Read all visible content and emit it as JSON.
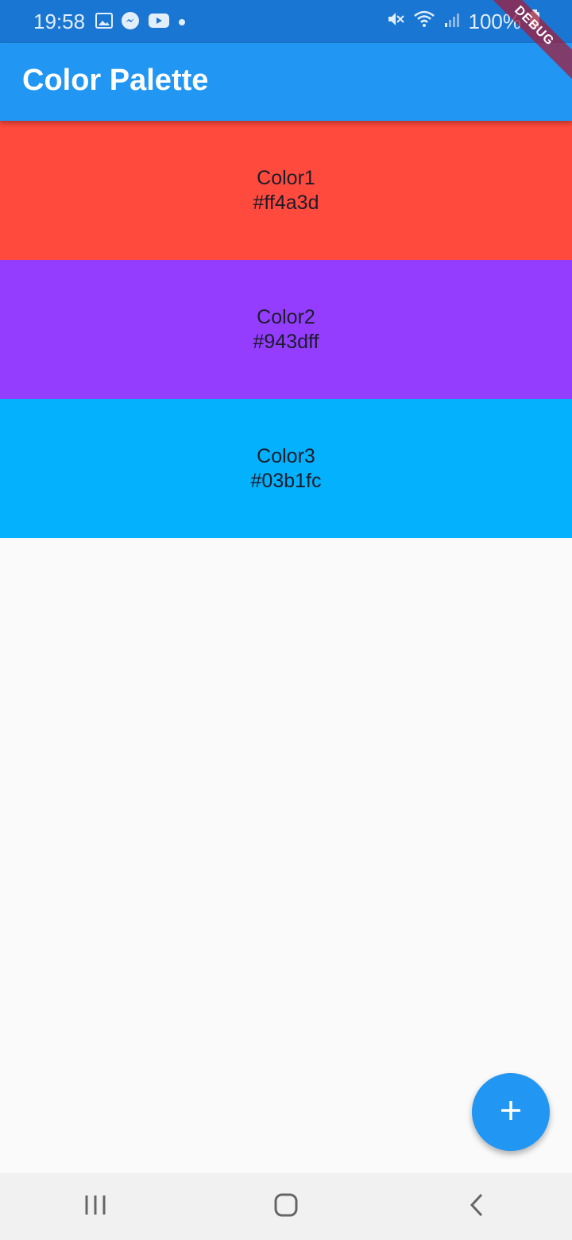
{
  "status_bar": {
    "time": "19:58",
    "battery_text": "100%",
    "icons_left": [
      "gallery-icon",
      "messenger-icon",
      "youtube-icon",
      "dot-icon"
    ],
    "icons_right": [
      "mute-icon",
      "wifi-icon",
      "signal-icon",
      "battery-icon"
    ]
  },
  "app_bar": {
    "title": "Color Palette"
  },
  "debug_banner": {
    "label": "DEBUG"
  },
  "colors": [
    {
      "name": "Color1",
      "hex": "#ff4a3d"
    },
    {
      "name": "Color2",
      "hex": "#943dff"
    },
    {
      "name": "Color3",
      "hex": "#03b1fc"
    }
  ],
  "fab": {
    "icon": "add-icon"
  },
  "nav_bar": {
    "buttons": [
      "recent-apps-icon",
      "home-icon",
      "back-icon"
    ]
  },
  "theme": {
    "primary": "#2196f3",
    "status_bar": "#1976d2",
    "background": "#fafafa"
  }
}
